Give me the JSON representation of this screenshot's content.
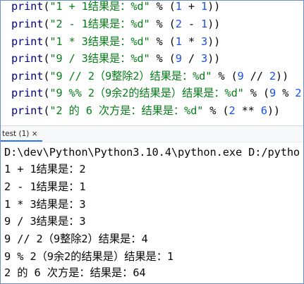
{
  "editor": {
    "lines": [
      {
        "print": "print",
        "open": "(",
        "str": "\"1 + 1结果是：%d\"",
        "mid": " % (",
        "a": "1",
        "op": " + ",
        "b": "1",
        "close": "))"
      },
      {
        "print": "print",
        "open": "(",
        "str": "\"2 - 1结果是：%d\"",
        "mid": " % (",
        "a": "2",
        "op": " - ",
        "b": "1",
        "close": "))"
      },
      {
        "print": "print",
        "open": "(",
        "str": "\"1 * 3结果是：%d\"",
        "mid": " % (",
        "a": "1",
        "op": " * ",
        "b": "3",
        "close": "))"
      },
      {
        "print": "print",
        "open": "(",
        "str": "\"9 / 3结果是：%d\"",
        "mid": " % (",
        "a": "9",
        "op": " / ",
        "b": "3",
        "close": "))"
      },
      {
        "print": "print",
        "open": "(",
        "str": "\"9 // 2（9整除2）结果是：%d\"",
        "mid": " % (",
        "a": "9",
        "op": " // ",
        "b": "2",
        "close": "))"
      },
      {
        "print": "print",
        "open": "(",
        "str": "\"9 %% 2（9余2的结果是）结果是：%d\"",
        "mid": " % (",
        "a": "9",
        "op": " % ",
        "b": "2",
        "close": "))"
      },
      {
        "print": "print",
        "open": "(",
        "str": "\"2 的 6 次方是：结果是：%d\"",
        "mid": " % (",
        "a": "2",
        "op": " ** ",
        "b": "6",
        "close": "))"
      }
    ]
  },
  "run_panel": {
    "tab_label": "test (1) ×",
    "command": "D:\\dev\\Python\\Python3.10.4\\python.exe D:/pytho",
    "output": [
      "1 + 1结果是：2",
      "2 - 1结果是：1",
      "1 * 3结果是：3",
      "9 / 3结果是：3",
      "9 // 2（9整除2）结果是：4",
      "9 % 2（9余2的结果是）结果是：1",
      "2 的 6 次方是：结果是：64"
    ]
  },
  "colors": {
    "function": "#000080",
    "string": "#067d17",
    "number": "#1750eb",
    "text": "#080808",
    "border": "#6d8fc2"
  }
}
